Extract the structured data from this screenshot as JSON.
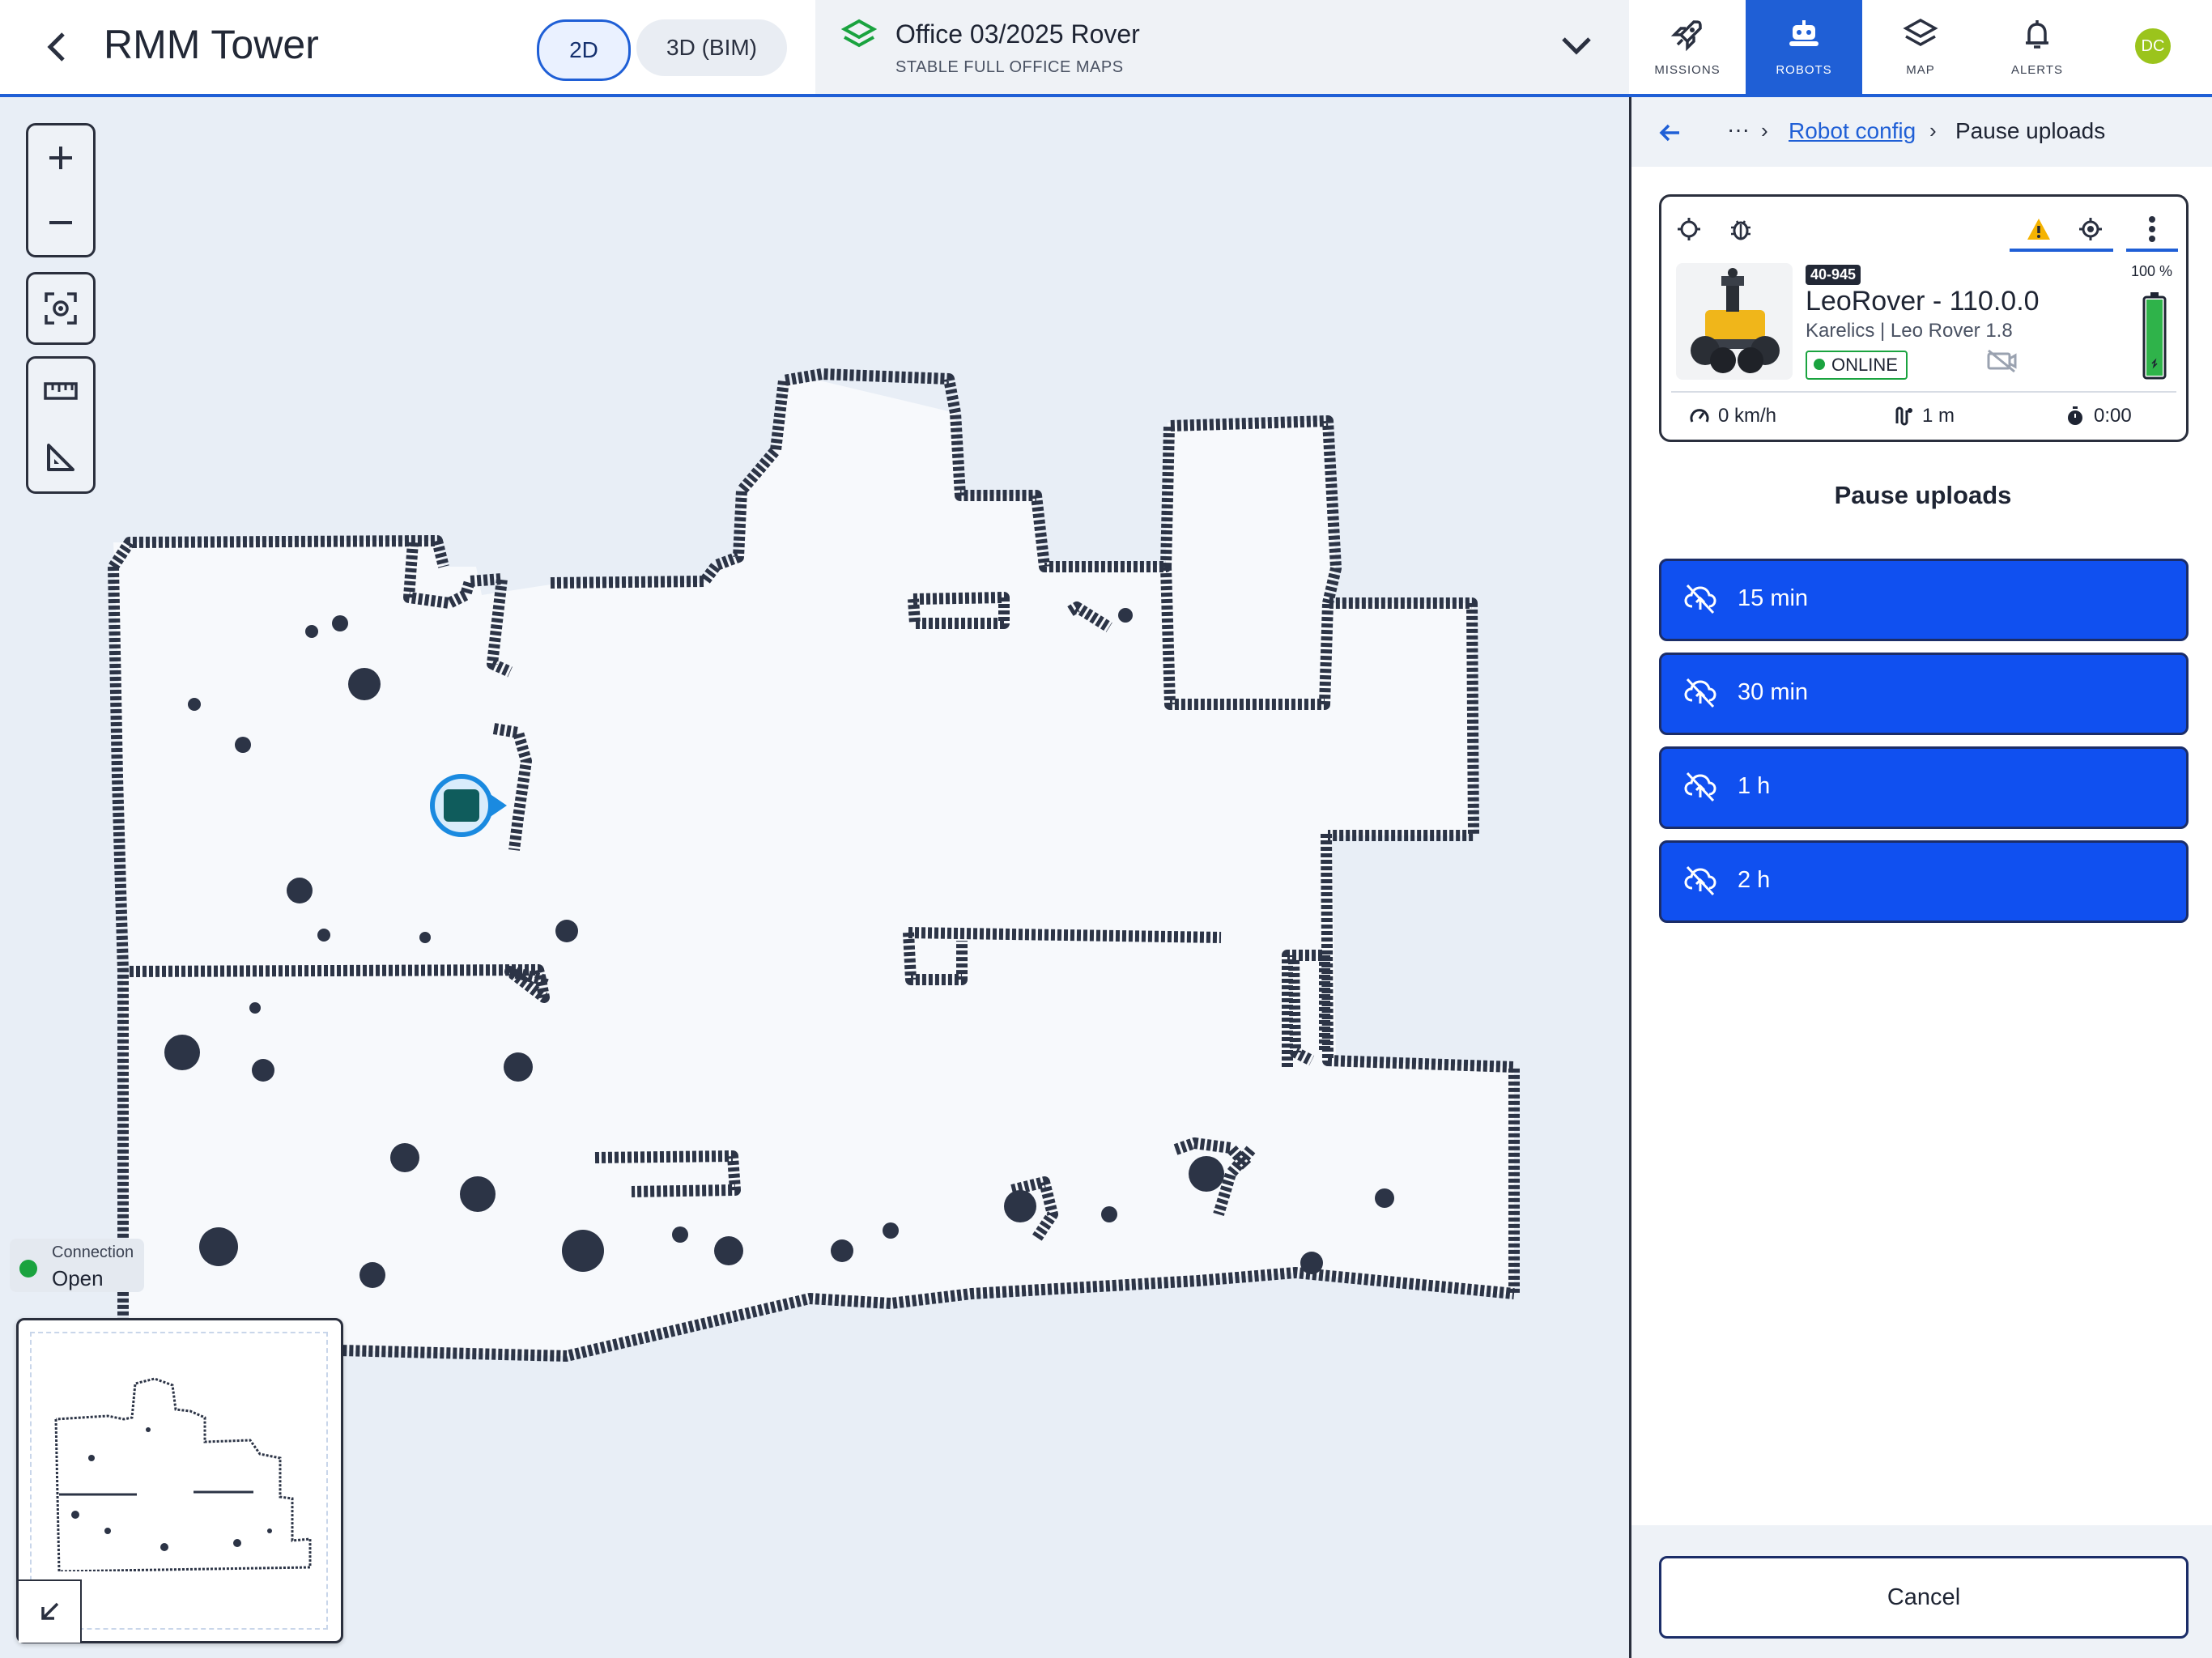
{
  "header": {
    "title": "RMM Tower",
    "view_2d": "2D",
    "view_3d": "3D (BIM)",
    "map_name": "Office 03/2025 Rover",
    "map_subtitle": "STABLE FULL OFFICE MAPS"
  },
  "nav": [
    {
      "label": "MISSIONS",
      "icon": "rocket-icon"
    },
    {
      "label": "ROBOTS",
      "icon": "robot-icon",
      "active": true
    },
    {
      "label": "MAP",
      "icon": "layers-icon"
    },
    {
      "label": "ALERTS",
      "icon": "bell-icon"
    }
  ],
  "user": {
    "initials": "DC",
    "avatar_color": "#9bc41c"
  },
  "connection": {
    "label": "Connection",
    "status": "Open"
  },
  "breadcrumb": {
    "more": "···",
    "parent": "Robot config",
    "current": "Pause uploads"
  },
  "robot": {
    "id": "40-945",
    "name": "LeoRover - 110.0.0",
    "model": "Karelics | Leo Rover 1.8",
    "status": "ONLINE",
    "battery": "100 %",
    "battery_level": 1.0,
    "speed": "0 km/h",
    "distance": "1 m",
    "duration": "0:00"
  },
  "pause": {
    "title": "Pause uploads",
    "options": [
      "15 min",
      "30 min",
      "1 h",
      "2 h"
    ],
    "cancel": "Cancel"
  },
  "colors": {
    "accent": "#1f5fd6",
    "button_blue": "#1050f0",
    "online": "#1aa33f",
    "warning": "#f5b301"
  }
}
